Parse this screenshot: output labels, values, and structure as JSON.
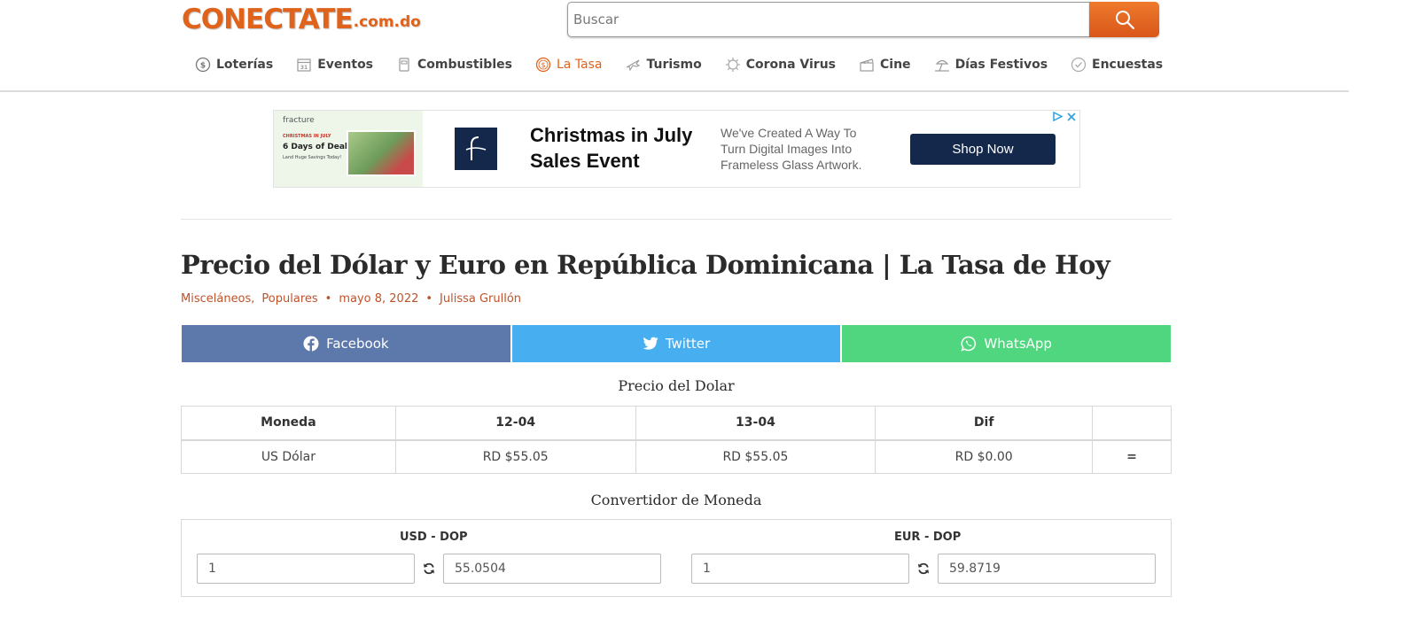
{
  "logo": {
    "main": "CONECTATE",
    "sub": ".com.do"
  },
  "search": {
    "placeholder": "Buscar"
  },
  "nav": {
    "items": [
      {
        "label": "Loterías"
      },
      {
        "label": "Eventos"
      },
      {
        "label": "Combustibles"
      },
      {
        "label": "La Tasa"
      },
      {
        "label": "Turismo"
      },
      {
        "label": "Corona Virus"
      },
      {
        "label": "Cine"
      },
      {
        "label": "Días Festivos"
      },
      {
        "label": "Encuestas"
      }
    ],
    "active_color": "#e0631c"
  },
  "ad": {
    "brand": "fracture",
    "thumb_kicker": "CHRISTMAS IN JULY",
    "thumb_headline": "6 Days of Deals",
    "thumb_tagline": "Land Huge Savings Today!",
    "title": "Christmas in July Sales Event",
    "description": "We've Created A Way To Turn Digital Images Into Frameless Glass Artwork.",
    "cta": "Shop Now"
  },
  "article": {
    "title": "Precio del Dólar y Euro en República Dominicana | La Tasa de Hoy",
    "categories": [
      "Misceláneos,",
      "Populares"
    ],
    "date": "mayo 8, 2022",
    "author": "Julissa Grullón"
  },
  "share": {
    "facebook": "Facebook",
    "twitter": "Twitter",
    "whatsapp": "WhatsApp"
  },
  "rates": {
    "title": "Precio del Dolar",
    "headers": [
      "Moneda",
      "12-04",
      "13-04",
      "Dif",
      ""
    ],
    "rows": [
      {
        "currency": "US Dólar",
        "prev": "RD $55.05",
        "curr": "RD $55.05",
        "diff": "RD $0.00",
        "trend": "="
      }
    ]
  },
  "converter": {
    "title": "Convertidor de Moneda",
    "usd": {
      "label": "USD - DOP",
      "amount": "1",
      "result": "55.0504"
    },
    "eur": {
      "label": "EUR - DOP",
      "amount": "1",
      "result": "59.8719"
    }
  },
  "colors": {
    "brand_orange": "#e0631c",
    "facebook": "#5d79ac",
    "twitter": "#47aef0",
    "whatsapp": "#4fd67e",
    "ad_navy": "#14284b"
  }
}
